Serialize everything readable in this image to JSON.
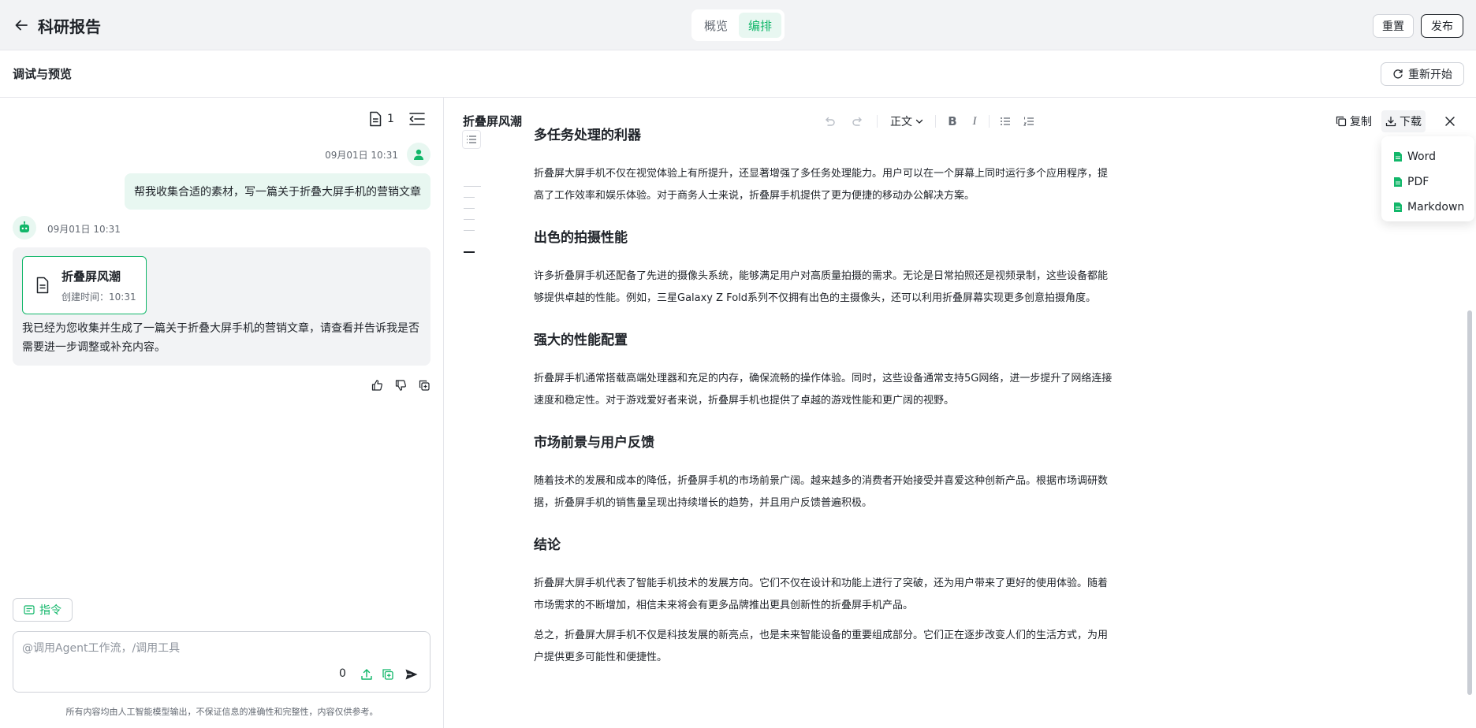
{
  "header": {
    "title": "科研报告",
    "tabs": [
      "概览",
      "编排"
    ],
    "reset_label": "重置",
    "publish_label": "发布"
  },
  "subheader": {
    "title": "调试与预览",
    "restart_label": "重新开始"
  },
  "chat": {
    "doc_count": "1",
    "user_time": "09月01日 10:31",
    "user_message": "帮我收集合适的素材，写一篇关于折叠大屏手机的营销文章",
    "bot_time": "09月01日 10:31",
    "doc_card": {
      "title": "折叠屏风潮",
      "subtitle": "创建时间：10:31"
    },
    "bot_message": "我已经为您收集并生成了一篇关于折叠大屏手机的营销文章，请查看并告诉我是否需要进一步调整或补充内容。",
    "command_label": "指令",
    "input_placeholder": "@调用Agent工作流，/调用工具",
    "char_count": "0",
    "disclaimer": "所有内容均由人工智能模型输出，不保证信息的准确性和完整性，内容仅供参考。"
  },
  "editor": {
    "doc_title": "折叠屏风潮",
    "text_style": "正文",
    "copy_label": "复制",
    "download_label": "下载",
    "download_options": [
      "Word",
      "PDF",
      "Markdown"
    ],
    "sections": [
      {
        "heading": "多任务处理的利器",
        "paragraphs": [
          "折叠屏大屏手机不仅在视觉体验上有所提升，还显著增强了多任务处理能力。用户可以在一个屏幕上同时运行多个应用程序，提高了工作效率和娱乐体验。对于商务人士来说，折叠屏手机提供了更为便捷的移动办公解决方案。"
        ]
      },
      {
        "heading": "出色的拍摄性能",
        "paragraphs": [
          "许多折叠屏手机还配备了先进的摄像头系统，能够满足用户对高质量拍摄的需求。无论是日常拍照还是视频录制，这些设备都能够提供卓越的性能。例如，三星Galaxy Z Fold系列不仅拥有出色的主摄像头，还可以利用折叠屏幕实现更多创意拍摄角度。"
        ]
      },
      {
        "heading": "强大的性能配置",
        "paragraphs": [
          "折叠屏手机通常搭载高端处理器和充足的内存，确保流畅的操作体验。同时，这些设备通常支持5G网络，进一步提升了网络连接速度和稳定性。对于游戏爱好者来说，折叠屏手机也提供了卓越的游戏性能和更广阔的视野。"
        ]
      },
      {
        "heading": "市场前景与用户反馈",
        "paragraphs": [
          "随着技术的发展和成本的降低，折叠屏手机的市场前景广阔。越来越多的消费者开始接受并喜爱这种创新产品。根据市场调研数据，折叠屏手机的销售量呈现出持续增长的趋势，并且用户反馈普遍积极。"
        ]
      },
      {
        "heading": "结论",
        "paragraphs": [
          "折叠屏大屏手机代表了智能手机技术的发展方向。它们不仅在设计和功能上进行了突破，还为用户带来了更好的使用体验。随着市场需求的不断增加，相信未来将会有更多品牌推出更具创新性的折叠屏手机产品。",
          "总之，折叠屏大屏手机不仅是科技发展的新亮点，也是未来智能设备的重要组成部分。它们正在逐步改变人们的生活方式，为用户提供更多可能性和便捷性。"
        ]
      }
    ]
  },
  "colors": {
    "accent": "#12b76a",
    "accent_bg": "#e8f7f1",
    "text": "#1f2329",
    "muted": "#646a73"
  }
}
